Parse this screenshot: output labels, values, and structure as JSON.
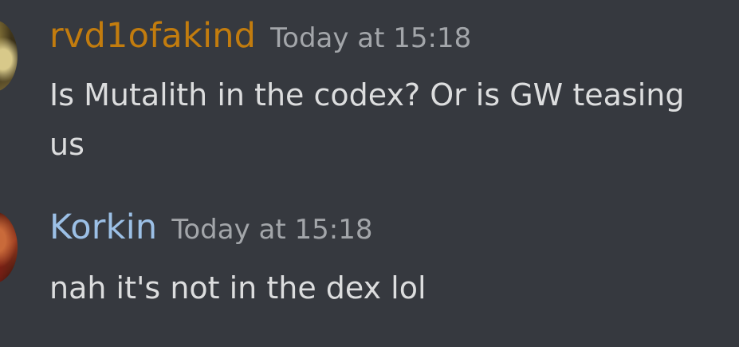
{
  "messages": [
    {
      "username": "rvd1ofakind",
      "username_color": "#c27c0e",
      "timestamp": "Today at 15:18",
      "text": "Is Mutalith in the codex? Or is GW teasing us"
    },
    {
      "username": "Korkin",
      "username_color": "#9cc0e6",
      "timestamp": "Today at 15:18",
      "text": "nah it's not in the dex lol"
    }
  ],
  "colors": {
    "background": "#36393f",
    "message_text": "#dcddde",
    "timestamp": "#a3a6aa"
  }
}
